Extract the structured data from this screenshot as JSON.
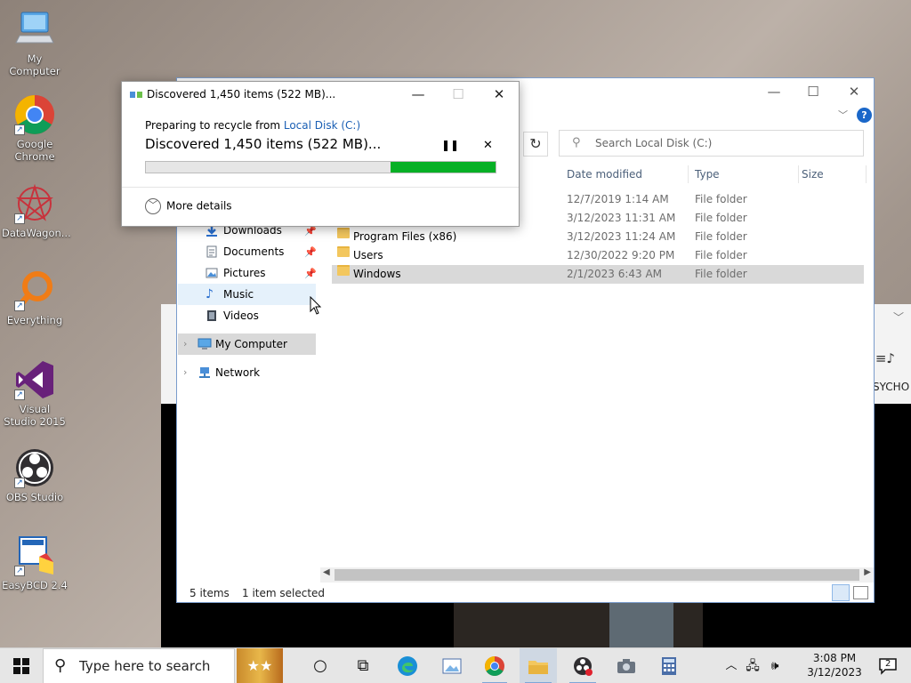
{
  "desktop": {
    "icons": [
      {
        "label": "My Computer",
        "icon": "computer-icon"
      },
      {
        "label": "Google Chrome",
        "icon": "chrome-icon"
      },
      {
        "label": "DataWagon...",
        "icon": "datawagon-icon"
      },
      {
        "label": "Everything",
        "icon": "everything-icon"
      },
      {
        "label": "Visual Studio 2015",
        "icon": "visual-studio-icon"
      },
      {
        "label": "OBS Studio",
        "icon": "obs-icon"
      },
      {
        "label": "EasyBCD 2.4",
        "icon": "easybcd-icon"
      }
    ]
  },
  "background_window": {
    "partial_text": "SYCHO"
  },
  "explorer": {
    "search_placeholder": "Search Local Disk (C:)",
    "columns": [
      "Date modified",
      "Type",
      "Size"
    ],
    "files": [
      {
        "name": "",
        "date": "12/7/2019 1:14 AM",
        "type": "File folder"
      },
      {
        "name": "",
        "date": "3/12/2023 11:31 AM",
        "type": "File folder"
      },
      {
        "name": "Program Files (x86)",
        "date": "3/12/2023 11:24 AM",
        "type": "File folder"
      },
      {
        "name": "Users",
        "date": "12/30/2022 9:20 PM",
        "type": "File folder"
      },
      {
        "name": "Windows",
        "date": "2/1/2023 6:43 AM",
        "type": "File folder",
        "selected": true
      }
    ],
    "nav": {
      "quick_access": [
        {
          "label": "Downloads",
          "pinned": true
        },
        {
          "label": "Documents",
          "pinned": true
        },
        {
          "label": "Pictures",
          "pinned": true
        },
        {
          "label": "Music",
          "pinned": false
        },
        {
          "label": "Videos",
          "pinned": false
        }
      ],
      "my_computer": "My Computer",
      "network": "Network"
    },
    "status": {
      "count": "5 items",
      "selected": "1 item selected"
    }
  },
  "dialog": {
    "title": "Discovered 1,450 items (522 MB)...",
    "preparing_prefix": "Preparing to recycle from ",
    "preparing_link": "Local Disk (C:)",
    "headline": "Discovered 1,450 items (522 MB)...",
    "progress_label_fraction": 0.3,
    "more_details": "More details",
    "accent": "#06b025"
  },
  "taskbar": {
    "search_placeholder": "Type here to search",
    "time": "3:08 PM",
    "date": "3/12/2023",
    "notification_count": "2"
  }
}
